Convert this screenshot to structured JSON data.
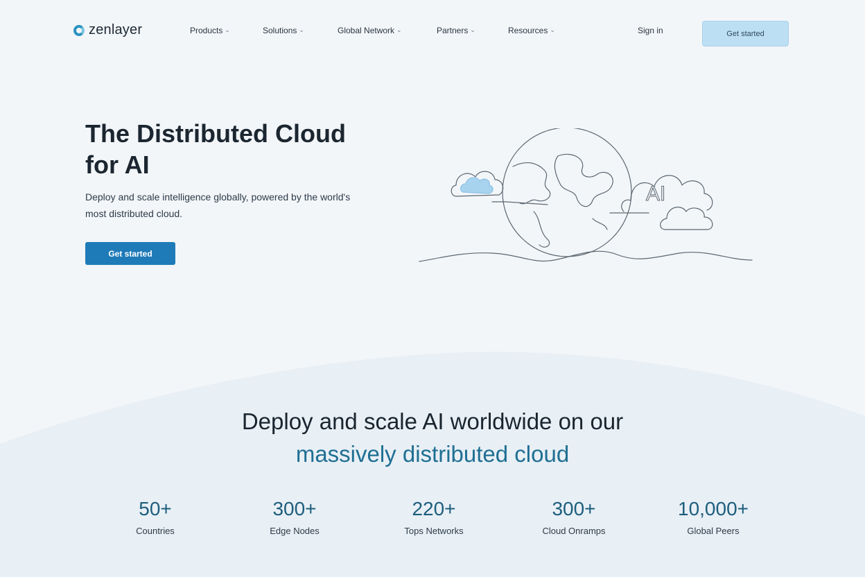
{
  "brand": {
    "name": "zenlayer",
    "accent": "#1f7bb8"
  },
  "nav": {
    "items": [
      {
        "label": "Products"
      },
      {
        "label": "Solutions"
      },
      {
        "label": "Global Network"
      },
      {
        "label": "Partners"
      },
      {
        "label": "Resources"
      }
    ],
    "sign_in": "Sign in",
    "cta": "Get started"
  },
  "hero": {
    "title_line1": "The Distributed Cloud",
    "title_line2": "for AI",
    "subtitle_line1": "Deploy and scale intelligence globally, powered by the world's",
    "subtitle_line2": "most distributed cloud.",
    "cta": "Get started",
    "illustration_text": "AI"
  },
  "section": {
    "title_line1": "Deploy and scale AI worldwide on our",
    "title_line2": "massively distributed cloud"
  },
  "stats": [
    {
      "value": "50+",
      "label": "Countries"
    },
    {
      "value": "300+",
      "label": "Edge Nodes"
    },
    {
      "value": "220+",
      "label": "Tops Networks"
    },
    {
      "value": "300+",
      "label": "Cloud Onramps"
    },
    {
      "value": "10,000+",
      "label": "Global Peers"
    }
  ]
}
